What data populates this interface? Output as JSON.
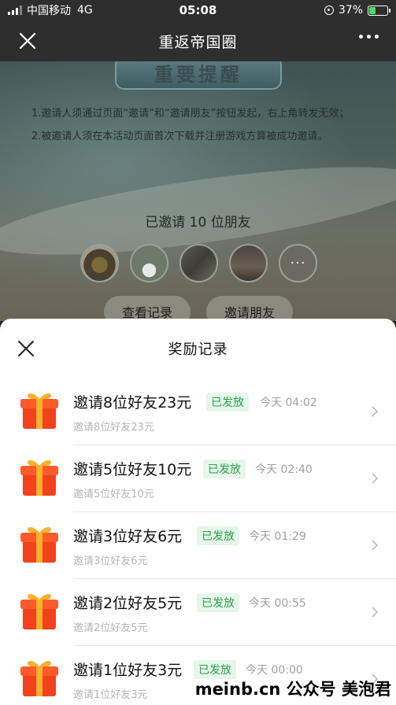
{
  "status_bar": {
    "carrier": "中国移动",
    "network": "4G",
    "time": "05:08",
    "battery": "37%",
    "battery_level": 0.37
  },
  "nav": {
    "title": "重返帝国圈"
  },
  "background": {
    "reminder_title": "重要提醒",
    "rules": [
      "1.邀请人须通过页面“邀请”和“邀请朋友”按钮发起，右上角转发无效；",
      "2.被邀请人须在本活动页面首次下载并注册游戏方算被成功邀请。"
    ],
    "invited_text": "已邀请 10 位朋友",
    "more_avatars": "···",
    "view_records_label": "查看记录",
    "invite_friends_label": "邀请朋友"
  },
  "sheet": {
    "title": "奖励记录",
    "records": [
      {
        "title": "邀请8位好友23元",
        "status": "已发放",
        "time": "今天 04:02",
        "subtitle": "邀请8位好友23元"
      },
      {
        "title": "邀请5位好友10元",
        "status": "已发放",
        "time": "今天 02:40",
        "subtitle": "邀请5位好友10元"
      },
      {
        "title": "邀请3位好友6元",
        "status": "已发放",
        "time": "今天 01:29",
        "subtitle": "邀请3位好友6元"
      },
      {
        "title": "邀请2位好友5元",
        "status": "已发放",
        "time": "今天 00:55",
        "subtitle": "邀请2位好友5元"
      },
      {
        "title": "邀请1位好友3元",
        "status": "已发放",
        "time": "今天 00:00",
        "subtitle": "邀请1位好友3元"
      }
    ]
  },
  "watermark": "meinb.cn 公众号 美泡君",
  "colors": {
    "accent_green": "#2aa246",
    "badge_bg": "#e6f6ea",
    "gift_red": "#f0421c",
    "gift_gold": "#f7b12a"
  }
}
